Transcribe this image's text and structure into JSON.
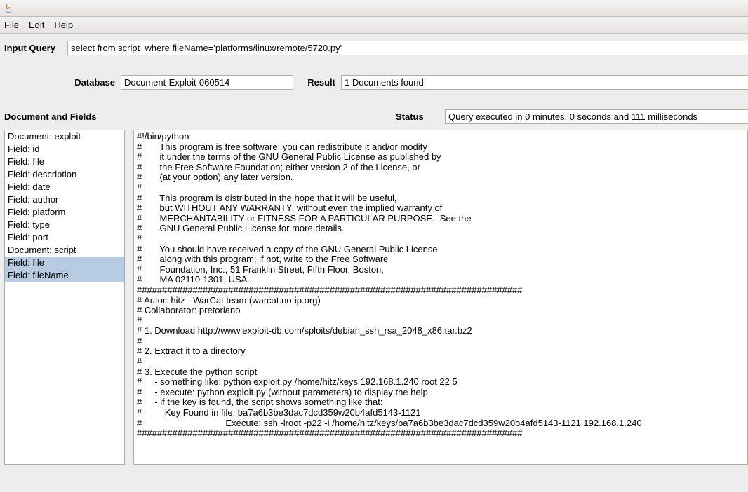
{
  "menubar": {
    "file": "File",
    "edit": "Edit",
    "help": "Help"
  },
  "labels": {
    "input_query": "Input Query",
    "database": "Database",
    "result": "Result",
    "doc_fields": "Document and Fields",
    "status": "Status"
  },
  "fields": {
    "input_query": "select from script  where fileName='platforms/linux/remote/5720.py'",
    "database": "Document-Exploit-060514",
    "result": "1 Documents found",
    "status": "Query executed in 0 minutes, 0 seconds and 111 milliseconds"
  },
  "list_items": [
    {
      "text": "Document: exploit",
      "sel": false
    },
    {
      "text": "Field: id",
      "sel": false
    },
    {
      "text": "Field: file",
      "sel": false
    },
    {
      "text": "Field: description",
      "sel": false
    },
    {
      "text": "Field: date",
      "sel": false
    },
    {
      "text": "Field: author",
      "sel": false
    },
    {
      "text": "Field: platform",
      "sel": false
    },
    {
      "text": "Field: type",
      "sel": false
    },
    {
      "text": "Field: port",
      "sel": false
    },
    {
      "text": "Document: script",
      "sel": false
    },
    {
      "text": "Field: file",
      "sel": true
    },
    {
      "text": "Field: fileName",
      "sel": true
    }
  ],
  "script_body": "#!/bin/python\n#       This program is free software; you can redistribute it and/or modify\n#       it under the terms of the GNU General Public License as published by\n#       the Free Software Foundation; either version 2 of the License, or\n#       (at your option) any later version.\n#\n#       This program is distributed in the hope that it will be useful,\n#       but WITHOUT ANY WARRANTY; without even the implied warranty of\n#       MERCHANTABILITY or FITNESS FOR A PARTICULAR PURPOSE.  See the\n#       GNU General Public License for more details.\n#\n#       You should have received a copy of the GNU General Public License\n#       along with this program; if not, write to the Free Software\n#       Foundation, Inc., 51 Franklin Street, Fifth Floor, Boston,\n#       MA 02110-1301, USA.\n############################################################################\n# Autor: hitz - WarCat team (warcat.no-ip.org)\n# Collaborator: pretoriano\n#\n# 1. Download http://www.exploit-db.com/sploits/debian_ssh_rsa_2048_x86.tar.bz2\n#\n# 2. Extract it to a directory\n#\n# 3. Execute the python script\n#     - something like: python exploit.py /home/hitz/keys 192.168.1.240 root 22 5\n#     - execute: python exploit.py (without parameters) to display the help\n#     - if the key is found, the script shows something like that:\n#         Key Found in file: ba7a6b3be3dac7dcd359w20b4afd5143-1121\n#                                 Execute: ssh -lroot -p22 -i /home/hitz/keys/ba7a6b3be3dac7dcd359w20b4afd5143-1121 192.168.1.240\n############################################################################\n"
}
